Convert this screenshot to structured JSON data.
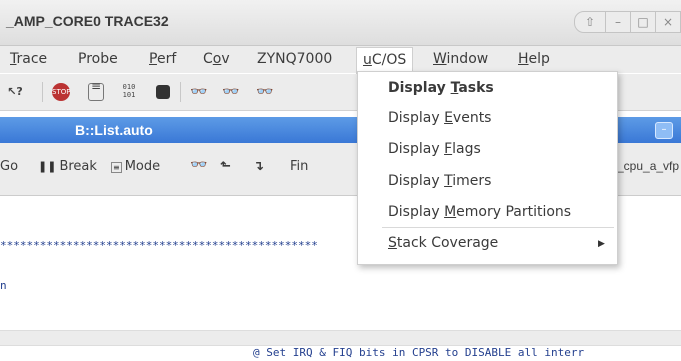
{
  "window": {
    "title": "_AMP_CORE0 TRACE32",
    "controls": [
      "⇧",
      "–",
      "□",
      "×"
    ]
  },
  "menubar": {
    "items": [
      {
        "pre": "",
        "ul": "T",
        "post": "race"
      },
      {
        "pre": "Probe",
        "ul": "",
        "post": ""
      },
      {
        "pre": "",
        "ul": "P",
        "post": "erf"
      },
      {
        "pre": "C",
        "ul": "o",
        "post": "v"
      },
      {
        "pre": "ZYNQ7000",
        "ul": "",
        "post": ""
      },
      {
        "pre": "",
        "ul": "u",
        "post": "C/OS"
      },
      {
        "pre": "",
        "ul": "W",
        "post": "indow"
      },
      {
        "pre": "",
        "ul": "H",
        "post": "elp"
      }
    ]
  },
  "toolbar": {
    "icons": [
      "help-pointer-icon",
      "stop-icon",
      "list-icon",
      "binary-icon",
      "chip-icon",
      "glasses-icon",
      "glasses2-icon",
      "glasses3-icon"
    ]
  },
  "list_window": {
    "title": "B::List.auto",
    "minimize": "–"
  },
  "list_toolbar": {
    "go": "Go",
    "break": "Break",
    "mode": "Mode",
    "find": "Fin",
    "symbol": "_cpu_a_vfp"
  },
  "content": {
    "stars": "************************************************",
    "line_n": "n",
    "comment": "@ Set IRQ & FIQ bits in CPSR to DISABLE all interr"
  },
  "dropdown": {
    "items": [
      {
        "pre": "Display ",
        "ul": "T",
        "post": "asks",
        "bold": true
      },
      {
        "pre": "Display ",
        "ul": "E",
        "post": "vents"
      },
      {
        "pre": "Display ",
        "ul": "F",
        "post": "lags"
      },
      {
        "pre": "Display ",
        "ul": "T",
        "post": "imers"
      },
      {
        "pre": "Display ",
        "ul": "M",
        "post": "emory Partitions"
      },
      {
        "pre": "",
        "ul": "S",
        "post": "tack Coverage",
        "submenu": true
      }
    ]
  },
  "colors": {
    "accent": "#3a78d6",
    "code": "#24408f"
  }
}
